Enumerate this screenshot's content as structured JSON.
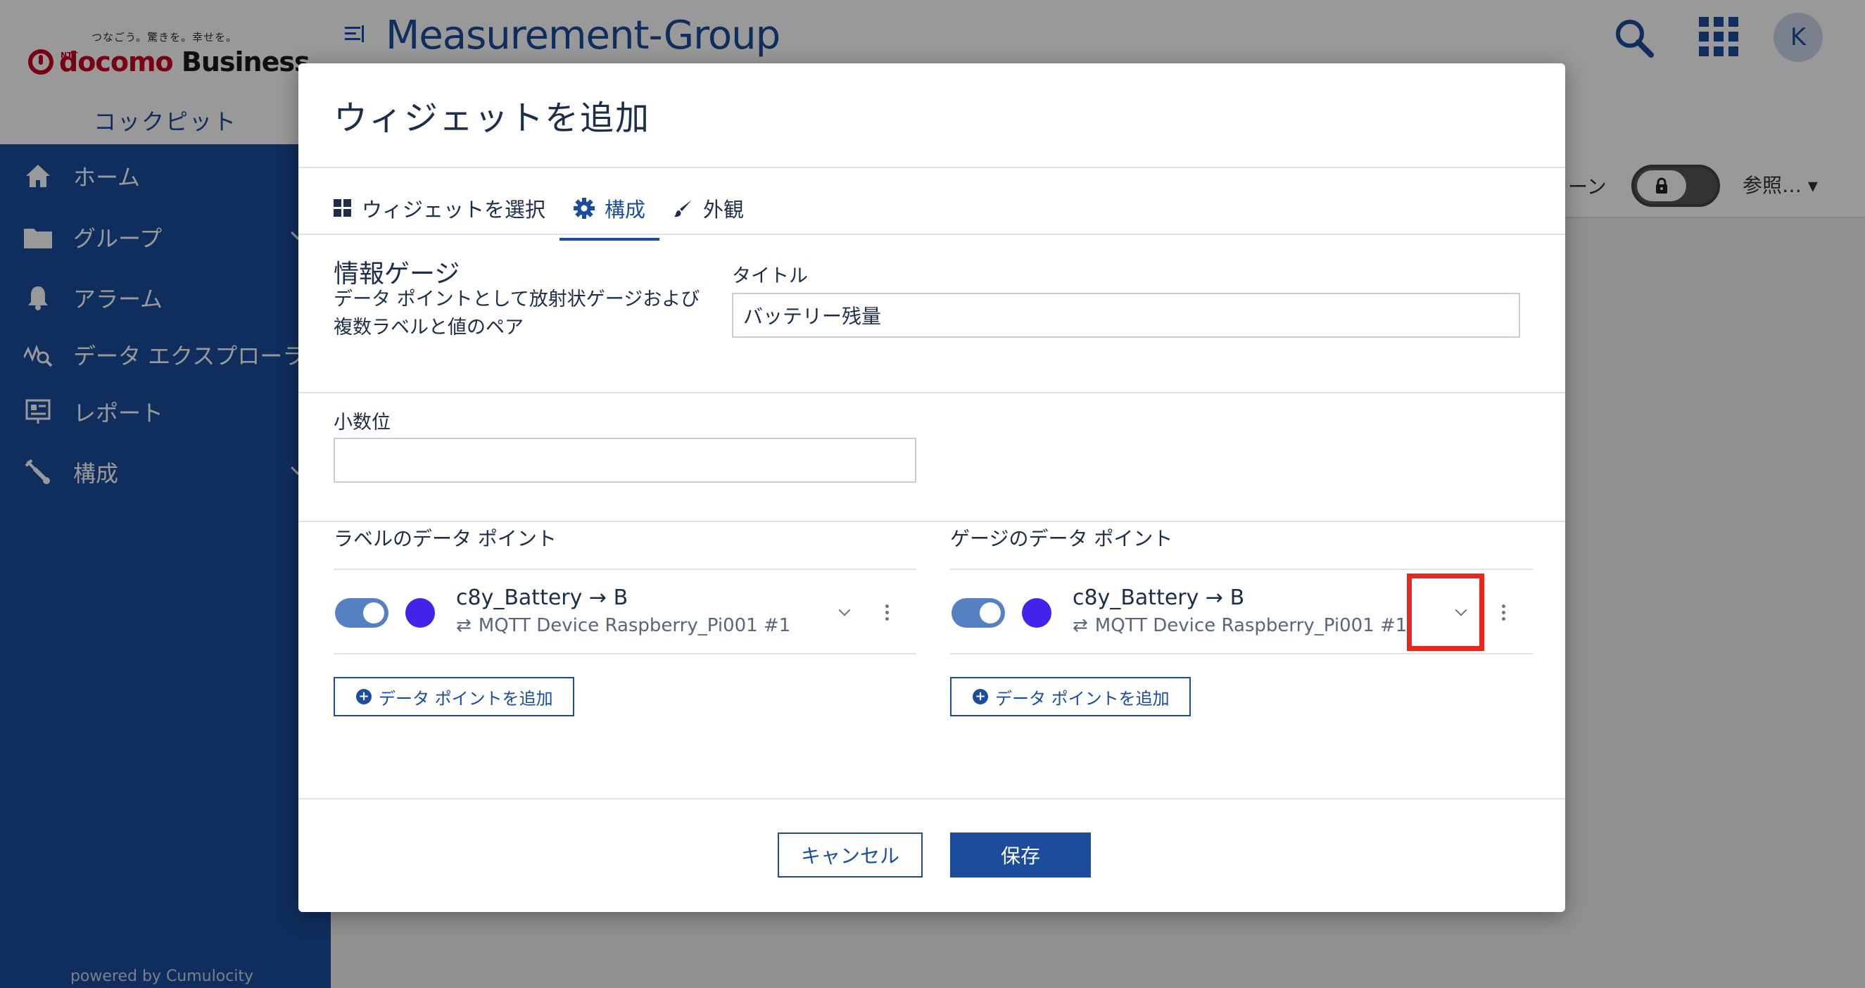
{
  "app": {
    "logo_tagline": "つなごう。驚きを。幸せを。",
    "logo_ntt": "NTT",
    "logo_docomo": "docomo",
    "logo_business": "Business",
    "cockpit": "コックピット",
    "page_title": "Measurement-Group",
    "avatar_initial": "K",
    "fullscreen_label": "リーン",
    "ref_menu": "参照…",
    "powered_by": "powered by Cumulocity",
    "accent_color": "#1b4d9c"
  },
  "sidebar": {
    "items": [
      {
        "label": "ホーム",
        "icon": "home-icon"
      },
      {
        "label": "グループ",
        "icon": "folder-icon"
      },
      {
        "label": "アラーム",
        "icon": "bell-icon"
      },
      {
        "label": "データ エクスプローラ",
        "icon": "data-explorer-icon"
      },
      {
        "label": "レポート",
        "icon": "report-icon"
      },
      {
        "label": "構成",
        "icon": "wrench-icon"
      }
    ]
  },
  "modal": {
    "title": "ウィジェットを追加",
    "tabs": [
      {
        "label": "ウィジェットを選択",
        "icon": "grid-icon"
      },
      {
        "label": "構成",
        "icon": "gear-icon",
        "active": true
      },
      {
        "label": "外観",
        "icon": "brush-icon"
      }
    ],
    "widget_name": "情報ゲージ",
    "widget_description": "データ ポイントとして放射状ゲージおよび複数ラベルと値のペア",
    "title_label": "タイトル",
    "title_value": "バッテリー残量",
    "decimals_label": "小数位",
    "decimals_value": "",
    "label_datapoints": {
      "heading": "ラベルのデータ ポイント",
      "items": [
        {
          "name": "c8y_Battery → B",
          "source": "MQTT Device Raspberry_Pi001 #1",
          "color": "#4322ea",
          "enabled": true
        }
      ],
      "add_label": "データ ポイントを追加"
    },
    "gauge_datapoints": {
      "heading": "ゲージのデータ ポイント",
      "items": [
        {
          "name": "c8y_Battery → B",
          "source": "MQTT Device Raspberry_Pi001 #1",
          "color": "#4322ea",
          "enabled": true
        }
      ],
      "add_label": "データ ポイントを追加"
    },
    "cancel_label": "キャンセル",
    "save_label": "保存"
  }
}
